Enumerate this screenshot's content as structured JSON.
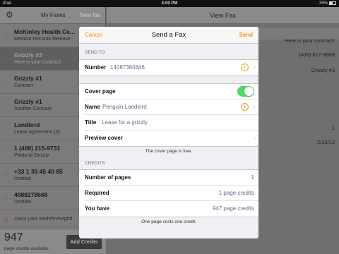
{
  "statusbar": {
    "carrier": "iPad",
    "time": "4:00 PM",
    "battery": "39%"
  },
  "sidebar": {
    "tabs": {
      "my_faxes": "My Faxes",
      "new_fax": "New fax"
    },
    "items": [
      {
        "title": "McKinley Health Ce...",
        "subtitle": "Medical Records Release",
        "status": "sent"
      },
      {
        "title": "Grizzly #3",
        "subtitle": "Here is your contract!",
        "status": "sent"
      },
      {
        "title": "Grizzly #1",
        "subtitle": "Contract",
        "status": "sent"
      },
      {
        "title": "Grizzly #1",
        "subtitle": "Another Contract",
        "status": "sent"
      },
      {
        "title": "Landlord",
        "subtitle": "Lease agreement (2)",
        "status": "sent"
      },
      {
        "title": "1 (408) 215-9731",
        "subtitle": "Photo of Grizzly",
        "status": "sent"
      },
      {
        "title": "+33 1 30 45 40 85",
        "subtitle": "Untitled",
        "status": "sent"
      },
      {
        "title": "4088278668",
        "subtitle": "Untitled",
        "status": "sent"
      },
      {
        "title": "Jvivui j our mrvfvhrvhvightf",
        "subtitle": "",
        "status": "failed"
      }
    ],
    "credits": {
      "count": "947",
      "label": "page credits available",
      "add_button": "Add Credits"
    }
  },
  "detail": {
    "title": "View Fax",
    "rows": [
      "Here is your contract!",
      "(408) 827-8668",
      "Grizzly #3",
      "1",
      "2/12/13"
    ]
  },
  "modal": {
    "cancel": "Cancel",
    "title": "Send a Fax",
    "send": "Send",
    "send_to_header": "SEND TO",
    "number_label": "Number",
    "number_value": "14087364846",
    "cover_label": "Cover page",
    "name_label": "Name",
    "name_value": "Penguin Landlord",
    "title_label": "Title",
    "title_value": "Lease for a grizzly",
    "preview_label": "Preview cover",
    "cover_note": "The cover page is free.",
    "credits_header": "CREDITS",
    "pages_label": "Number of pages",
    "pages_value": "1",
    "required_label": "Required",
    "required_value": "1 page credits",
    "have_label": "You have",
    "have_value": "947 page credits",
    "credit_note": "One page costs one credit."
  },
  "colors": {
    "accent": "#ff9500",
    "toggle_on": "#4cd964",
    "check": "#2e9a2e"
  }
}
